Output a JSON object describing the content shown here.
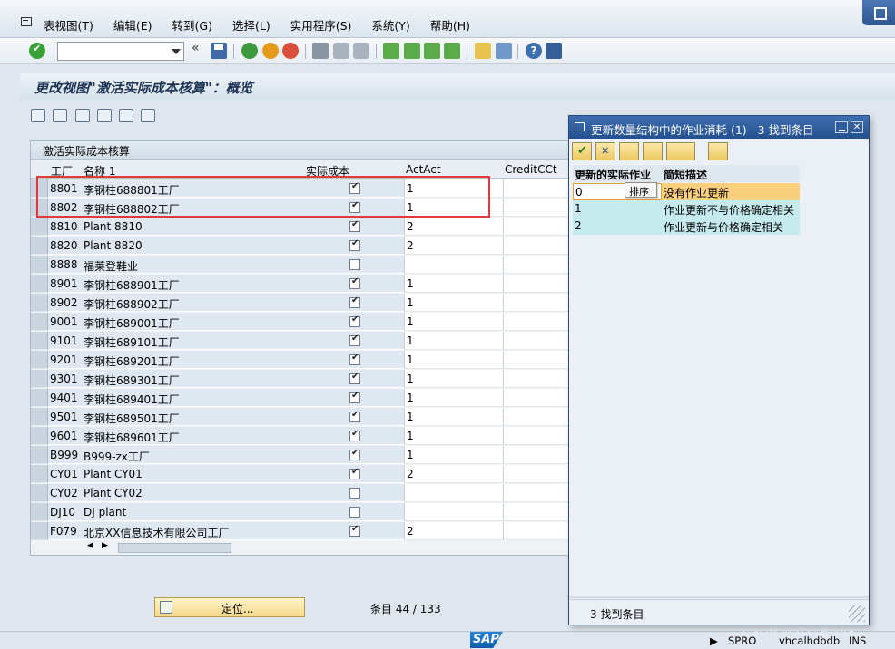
{
  "menu": {
    "items": [
      "表视图(T)",
      "编辑(E)",
      "转到(G)",
      "选择(L)",
      "实用程序(S)",
      "系统(Y)",
      "帮助(H)"
    ]
  },
  "toolbar": {
    "command_value": "",
    "double_left": "«"
  },
  "screen_title": "更改视图\"激活实际成本核算\"：概览",
  "table": {
    "title": "激活实际成本核算",
    "headers": [
      "工厂",
      "名称 1",
      "实际成本",
      "ActAct",
      "CreditCCt"
    ],
    "rows": [
      {
        "plant": "8801",
        "name": "李钢柱688801工厂",
        "checked": true,
        "actact": "1"
      },
      {
        "plant": "8802",
        "name": "李钢柱688802工厂",
        "checked": true,
        "actact": "1"
      },
      {
        "plant": "8810",
        "name": "Plant 8810",
        "checked": true,
        "actact": "2"
      },
      {
        "plant": "8820",
        "name": "Plant 8820",
        "checked": true,
        "actact": "2"
      },
      {
        "plant": "8888",
        "name": "福莱登鞋业",
        "checked": false,
        "actact": ""
      },
      {
        "plant": "8901",
        "name": "李钢柱688901工厂",
        "checked": true,
        "actact": "1"
      },
      {
        "plant": "8902",
        "name": "李钢柱688902工厂",
        "checked": true,
        "actact": "1"
      },
      {
        "plant": "9001",
        "name": "李钢柱689001工厂",
        "checked": true,
        "actact": "1"
      },
      {
        "plant": "9101",
        "name": "李钢柱689101工厂",
        "checked": true,
        "actact": "1"
      },
      {
        "plant": "9201",
        "name": "李钢柱689201工厂",
        "checked": true,
        "actact": "1"
      },
      {
        "plant": "9301",
        "name": "李钢柱689301工厂",
        "checked": true,
        "actact": "1"
      },
      {
        "plant": "9401",
        "name": "李钢柱689401工厂",
        "checked": true,
        "actact": "1"
      },
      {
        "plant": "9501",
        "name": "李钢柱689501工厂",
        "checked": true,
        "actact": "1"
      },
      {
        "plant": "9601",
        "name": "李钢柱689601工厂",
        "checked": true,
        "actact": "1"
      },
      {
        "plant": "B999",
        "name": "B999-zx工厂",
        "checked": true,
        "actact": "1"
      },
      {
        "plant": "CY01",
        "name": "Plant CY01",
        "checked": true,
        "actact": "2"
      },
      {
        "plant": "CY02",
        "name": "Plant CY02",
        "checked": false,
        "actact": ""
      },
      {
        "plant": "DJ10",
        "name": "DJ plant",
        "checked": false,
        "actact": ""
      },
      {
        "plant": "F079",
        "name": "北京XX信息技术有限公司工厂",
        "checked": true,
        "actact": "2"
      }
    ]
  },
  "locate_button": "定位...",
  "entries_label": "条目 44 / 133",
  "statusbar": {
    "transaction": "SPRO",
    "server": "vhcalhdbdb",
    "mode": "INS",
    "logo": "SAP"
  },
  "watermark": "CSDN @欢行者SAP",
  "popup": {
    "title": "更新数量结构中的作业消耗 (1)",
    "count": "3 找到条目",
    "headers": [
      "更新的实际作业",
      "简短描述"
    ],
    "rows": [
      {
        "value": "0",
        "desc": "没有作业更新"
      },
      {
        "value": "1",
        "desc": "作业更新不与价格确定相关"
      },
      {
        "value": "2",
        "desc": "作业更新与价格确定相关"
      }
    ],
    "tooltip": "排序",
    "status": "3 找到条目"
  }
}
